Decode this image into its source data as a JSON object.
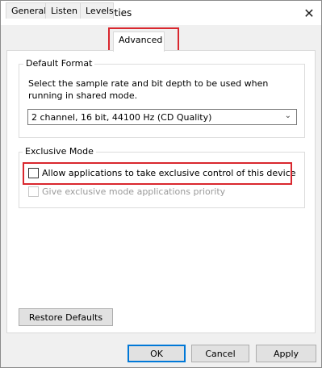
{
  "window": {
    "title": "Microphone Properties",
    "close_glyph": "✕"
  },
  "tabs": [
    {
      "label": "General"
    },
    {
      "label": "Listen"
    },
    {
      "label": "Levels"
    },
    {
      "label": "Advanced"
    }
  ],
  "default_format": {
    "group_label": "Default Format",
    "description": "Select the sample rate and bit depth to be used when running in shared mode.",
    "selected_value": "2 channel, 16 bit, 44100 Hz (CD Quality)",
    "dropdown_glyph": "⌄"
  },
  "exclusive_mode": {
    "group_label": "Exclusive Mode",
    "allow_exclusive_label": "Allow applications to take exclusive control of this device",
    "priority_label": "Give exclusive mode applications priority"
  },
  "buttons": {
    "restore_defaults": "Restore Defaults",
    "ok": "OK",
    "cancel": "Cancel",
    "apply": "Apply"
  },
  "colors": {
    "highlight": "#d9272e",
    "default_button_border": "#0078d7"
  }
}
